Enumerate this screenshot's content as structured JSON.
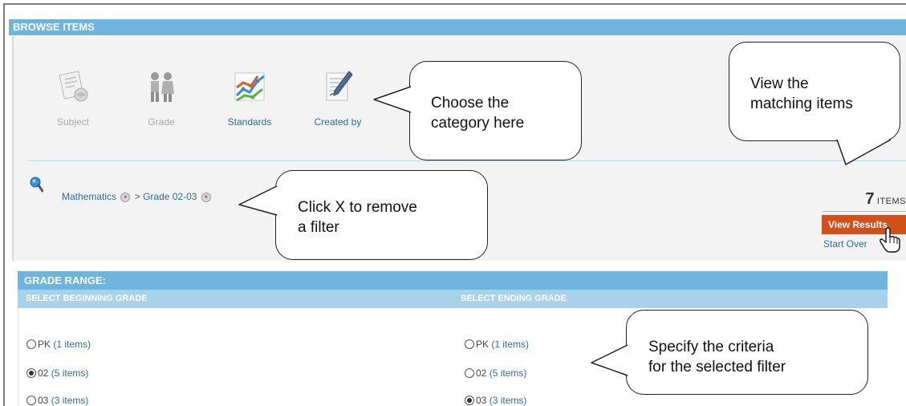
{
  "header": {
    "title": "BROWSE ITEMS"
  },
  "categories": [
    {
      "label": "Subject",
      "icon": "subject-icon",
      "state": "disabled"
    },
    {
      "label": "Grade",
      "icon": "grade-icon",
      "state": "disabled"
    },
    {
      "label": "Standards",
      "icon": "standards-icon",
      "state": "enabled"
    },
    {
      "label": "Created by",
      "icon": "created-by-icon",
      "state": "enabled"
    }
  ],
  "filters": {
    "items": [
      "Mathematics",
      "Grade 02-03"
    ],
    "separator": ">",
    "remove_symbol": "×"
  },
  "results": {
    "count": "7",
    "unit": "ITEMS",
    "view_button": "View Results",
    "start_over": "Start Over"
  },
  "grade_range": {
    "title": "GRADE RANGE:",
    "begin_label": "SELECT BEGINNING GRADE",
    "end_label": "SELECT ENDING GRADE",
    "begin_options": [
      {
        "grade": "PK",
        "count": "(1 items)",
        "selected": false
      },
      {
        "grade": "02",
        "count": "(5 items)",
        "selected": true
      },
      {
        "grade": "03",
        "count": "(3 items)",
        "selected": false
      }
    ],
    "end_options": [
      {
        "grade": "PK",
        "count": "(1 items)",
        "selected": false
      },
      {
        "grade": "02",
        "count": "(5 items)",
        "selected": false
      },
      {
        "grade": "03",
        "count": "(3 items)",
        "selected": true
      }
    ]
  },
  "callouts": {
    "category": [
      "Choose the",
      "category here"
    ],
    "remove": [
      "Click X to remove",
      "a filter"
    ],
    "results": [
      "View the",
      "matching items"
    ],
    "criteria": [
      "Specify the criteria",
      "for the selected filter"
    ]
  },
  "colors": {
    "header_blue": "#6eb4dd",
    "subheader_blue": "#a8d1ea",
    "link_blue": "#2a6ca8",
    "button_orange": "#d1511d"
  }
}
